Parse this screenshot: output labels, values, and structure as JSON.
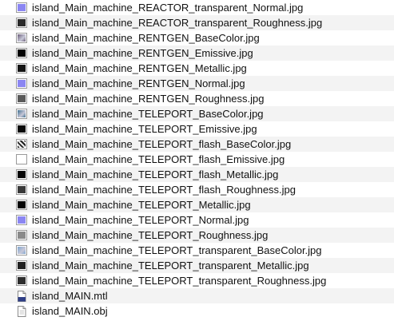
{
  "files": [
    {
      "name": "island_Main_machine_REACTOR_transparent_Normal.jpg",
      "icon": "normal-map-thumbnail-icon",
      "swatch": "#8b86f2"
    },
    {
      "name": "island_Main_machine_REACTOR_transparent_Roughness.jpg",
      "icon": "dark-thumbnail-icon",
      "swatch": "#2a2a2a"
    },
    {
      "name": "island_Main_machine_RENTGEN_BaseColor.jpg",
      "icon": "color-thumbnail-icon",
      "swatch": "#6a5d78"
    },
    {
      "name": "island_Main_machine_RENTGEN_Emissive.jpg",
      "icon": "black-thumbnail-icon",
      "swatch": "#050505"
    },
    {
      "name": "island_Main_machine_RENTGEN_Metallic.jpg",
      "icon": "black-thumbnail-icon",
      "swatch": "#151515"
    },
    {
      "name": "island_Main_machine_RENTGEN_Normal.jpg",
      "icon": "normal-map-thumbnail-icon",
      "swatch": "#8b86f2"
    },
    {
      "name": "island_Main_machine_RENTGEN_Roughness.jpg",
      "icon": "gray-thumbnail-icon",
      "swatch": "#5a5a5a"
    },
    {
      "name": "island_Main_machine_TELEPORT_BaseColor.jpg",
      "icon": "color-thumbnail-icon",
      "swatch": "#3f6e8e"
    },
    {
      "name": "island_Main_machine_TELEPORT_Emissive.jpg",
      "icon": "black-thumbnail-icon",
      "swatch": "#0a0a0a"
    },
    {
      "name": "island_Main_machine_TELEPORT_flash_BaseColor.jpg",
      "icon": "pattern-thumbnail-icon",
      "swatch": "#d0d0d0"
    },
    {
      "name": "island_Main_machine_TELEPORT_flash_Emissive.jpg",
      "icon": "white-thumbnail-icon",
      "swatch": "#ffffff"
    },
    {
      "name": "island_Main_machine_TELEPORT_flash_Metallic.jpg",
      "icon": "black-thumbnail-icon",
      "swatch": "#050505"
    },
    {
      "name": "island_Main_machine_TELEPORT_flash_Roughness.jpg",
      "icon": "dark-thumbnail-icon",
      "swatch": "#3a3a3a"
    },
    {
      "name": "island_Main_machine_TELEPORT_Metallic.jpg",
      "icon": "black-thumbnail-icon",
      "swatch": "#050505"
    },
    {
      "name": "island_Main_machine_TELEPORT_Normal.jpg",
      "icon": "normal-map-thumbnail-icon",
      "swatch": "#8b86f2"
    },
    {
      "name": "island_Main_machine_TELEPORT_Roughness.jpg",
      "icon": "gray-thumbnail-icon",
      "swatch": "#8a8a8a"
    },
    {
      "name": "island_Main_machine_TELEPORT_transparent_BaseColor.jpg",
      "icon": "color-thumbnail-icon",
      "swatch": "#7fa6cf"
    },
    {
      "name": "island_Main_machine_TELEPORT_transparent_Metallic.jpg",
      "icon": "dark-thumbnail-icon",
      "swatch": "#202020"
    },
    {
      "name": "island_Main_machine_TELEPORT_transparent_Roughness.jpg",
      "icon": "dark-thumbnail-icon",
      "swatch": "#2e2e2e"
    },
    {
      "name": "island_MAIN.mtl",
      "icon": "mtl-file-icon",
      "swatch": ""
    },
    {
      "name": "island_MAIN.obj",
      "icon": "obj-file-icon",
      "swatch": ""
    }
  ]
}
